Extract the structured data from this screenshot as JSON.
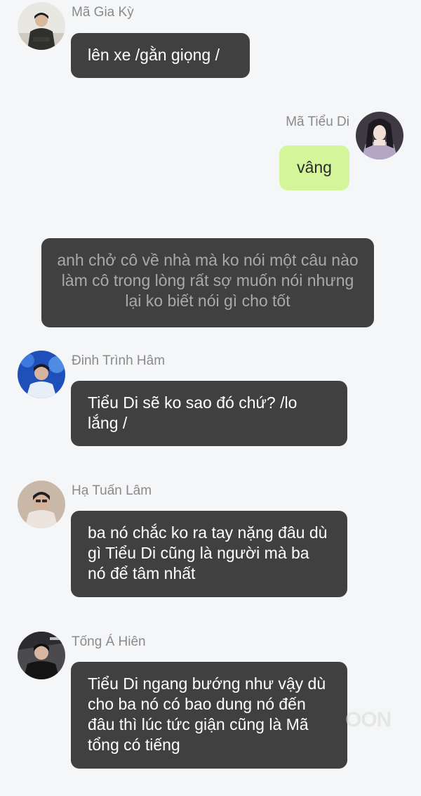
{
  "messages": [
    {
      "speaker": "Mã Gia Kỳ",
      "text": "lên xe /gằn giọng /"
    },
    {
      "speaker": "Mã Tiểu Di",
      "text": "vâng"
    },
    {
      "narration": "anh chở cô về nhà mà ko nói một câu nào làm cô trong lòng rất sợ muốn nói nhưng lại ko biết nói gì cho tốt"
    },
    {
      "speaker": "Đinh Trình Hâm",
      "text": "Tiểu Di sẽ ko sao đó chứ? /lo lắng /"
    },
    {
      "speaker": "Hạ Tuấn Lâm",
      "text": "ba nó chắc ko ra tay nặng đâu dù gì Tiểu Di cũng là người mà ba nó để tâm nhất"
    },
    {
      "speaker": "Tống Á Hiên",
      "text": "Tiểu Di ngang bướng như vậy dù cho ba nó có bao dung nó đến đâu thì lúc tức giận cũng là Mã tổng có tiếng"
    }
  ],
  "watermark": "OON",
  "colors": {
    "background": "#f5f6f8",
    "bubble_dark": "#404040",
    "bubble_self": "#d5f59a",
    "name_text": "#8a8a8a",
    "narration_text": "#a9a9a9"
  },
  "icons": [
    "avatar-ma-gia-ky",
    "avatar-ma-tieu-di",
    "avatar-dinh-trinh-ham",
    "avatar-ha-tuan-lam",
    "avatar-tong-a-hien"
  ]
}
